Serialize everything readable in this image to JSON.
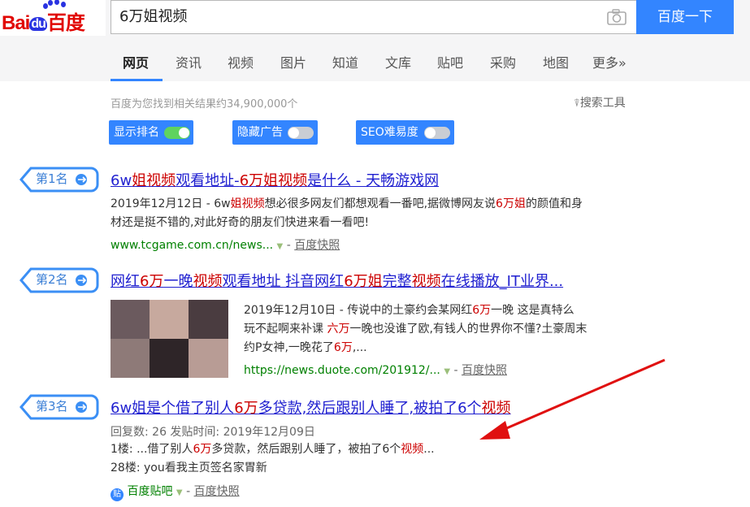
{
  "logo": {
    "part1": "Bai",
    "part2": "du",
    "part3": "百度"
  },
  "search": {
    "query": "6万姐视频",
    "button": "百度一下"
  },
  "tabs": [
    "网页",
    "资讯",
    "视频",
    "图片",
    "知道",
    "文库",
    "贴吧",
    "采购",
    "地图",
    "更多»"
  ],
  "result_count": "百度为您找到相关结果约34,900,000个",
  "tools_label": "搜索工具",
  "toggles": [
    {
      "label": "显示排名",
      "on": true
    },
    {
      "label": "隐藏广告",
      "on": false
    },
    {
      "label": "SEO难易度",
      "on": false
    }
  ],
  "results": [
    {
      "rank": "第1名",
      "title_parts": [
        "6w",
        "姐视频",
        "观看地址-",
        "6万姐视频",
        "是什么 - 天畅游戏网"
      ],
      "abstract_line1_parts": [
        "2019年12月12日 - 6w",
        "姐视频",
        "想必很多网友们都想观看一番吧,据微博网友说",
        "6万姐",
        "的颜值和身"
      ],
      "abstract_line2": "材还是挺不错的,对此好奇的朋友们快进来看一看吧!",
      "url": "www.tcgame.com.cn/news...",
      "snapshot": "百度快照"
    },
    {
      "rank": "第2名",
      "title_parts": [
        "网红",
        "6万",
        "一晚",
        "视频",
        "观看地址 抖音网红",
        "6万姐",
        "完整",
        "视频",
        "在线播放_IT业界..."
      ],
      "abstract_line1_parts": [
        "2019年12月10日 -       传说中的土豪约会某网红",
        "6万",
        "一晚 这是真特么"
      ],
      "abstract_line2_parts": [
        "玩不起啊来补课 ",
        "六万",
        "一晚也没谁了欧,有钱人的世界你不懂?土豪周末"
      ],
      "abstract_line3_parts": [
        "约P女神,一晚花了",
        "6万",
        ",..."
      ],
      "url": "https://news.duote.com/201912/...",
      "snapshot": "百度快照"
    },
    {
      "rank": "第3名",
      "title_parts": [
        "6w姐是个借了别人",
        "6万",
        "多贷款,然后跟别人睡了,被拍了6个",
        "视频"
      ],
      "meta": "回复数: 26 发贴时间: 2019年12月09日",
      "line1_parts": [
        "1楼: ...借了别人",
        "6万",
        "多贷款，然后跟别人睡了，被拍了6个",
        "视频",
        "..."
      ],
      "line2": "28楼: you看我主页签名家胃新",
      "source": "百度贴吧",
      "snapshot": "百度快照"
    }
  ],
  "colors": {
    "accent": "#3385ff",
    "link": "#2020d0",
    "highlight": "#cc0000",
    "url": "#008000",
    "arrow": "#e01010"
  }
}
